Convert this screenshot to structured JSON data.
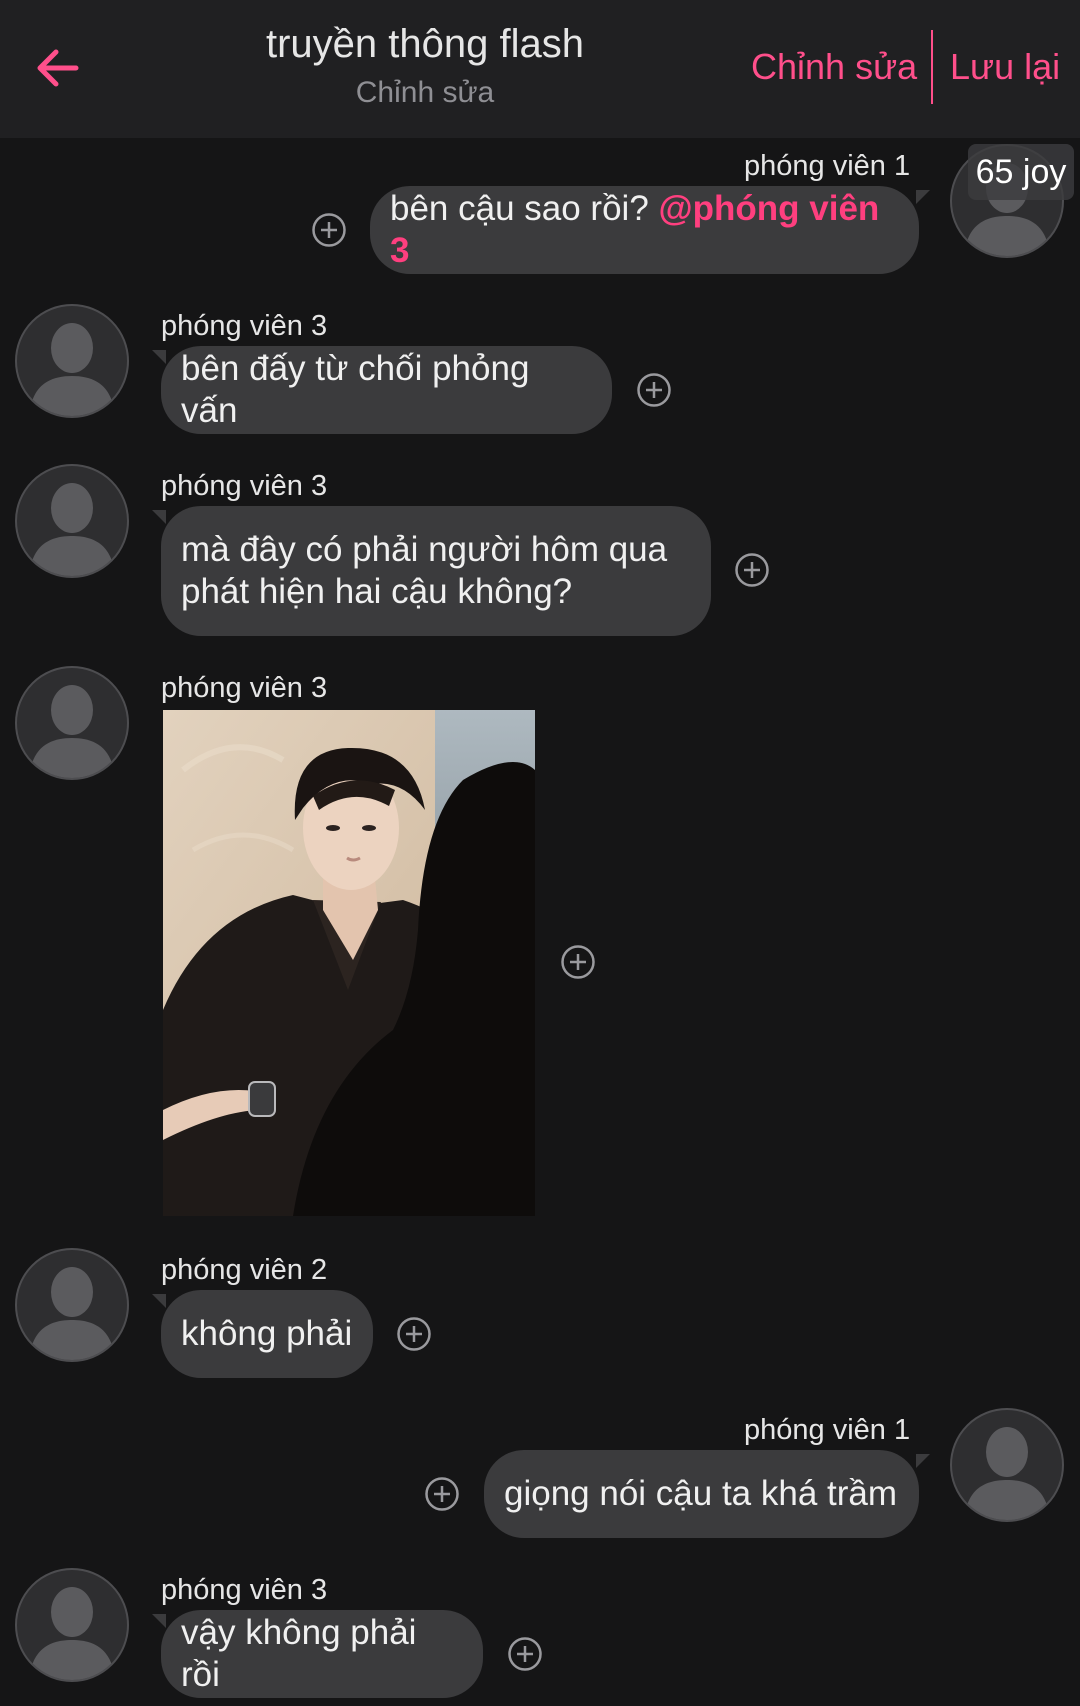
{
  "header": {
    "title": "truyền thông flash",
    "subtitle": "Chỉnh sửa",
    "edit_label": "Chỉnh sửa",
    "save_label": "Lưu lại"
  },
  "badge": "65 joy",
  "messages": [
    {
      "sender": "phóng viên 1",
      "text": "bên cậu sao rồi? ",
      "mention": "@phóng viên 3"
    },
    {
      "sender": "phóng viên 3",
      "text": "bên đấy từ chối phỏng vấn"
    },
    {
      "sender": "phóng viên 3",
      "text_line1": "mà đây có phải người hôm qua",
      "text_line2": "phát hiện hai cậu không?"
    },
    {
      "sender": "phóng viên 3",
      "image": "photo of a young man in a black suit with a wristwatch, facing another person in front of a mirror"
    },
    {
      "sender": "phóng viên 2",
      "text": "không phải"
    },
    {
      "sender": "phóng viên 1",
      "text": "giọng nói cậu ta khá trầm"
    },
    {
      "sender": "phóng viên 3",
      "text": "vậy không phải rồi"
    }
  ],
  "colors": {
    "accent": "#ff4f8b",
    "mention": "#ff3f7f",
    "background": "#151516",
    "header_bg": "#202022",
    "bubble": "#3b3b3d"
  },
  "icons": [
    "back-arrow-icon",
    "add-reaction-icon",
    "default-avatar-icon"
  ]
}
